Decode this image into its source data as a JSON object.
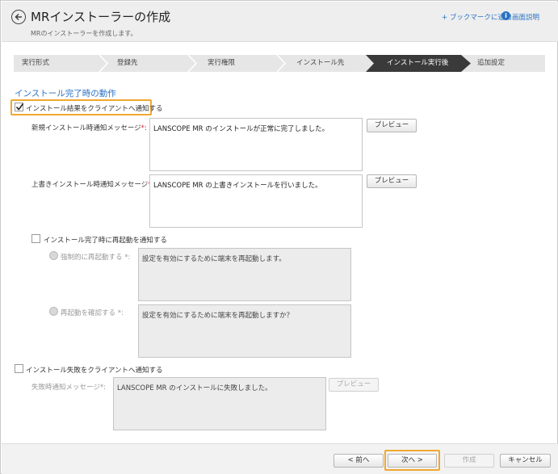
{
  "header": {
    "title": "MRインストーラーの作成",
    "subtitle": "MRのインストーラーを作成します。",
    "bookmark_label": "+ ブックマークに追加",
    "help_label": "画面説明",
    "info_glyph": "i"
  },
  "steps": [
    {
      "label": "実行形式",
      "active": false
    },
    {
      "label": "登録先",
      "active": false
    },
    {
      "label": "実行権限",
      "active": false
    },
    {
      "label": "インストール先",
      "active": false
    },
    {
      "label": "インストール実行後",
      "active": true
    },
    {
      "label": "追加設定",
      "active": false
    }
  ],
  "section": {
    "title": "インストール完了時の動作",
    "notify_result": {
      "label": "インストール結果をクライアントへ通知する",
      "checked": true
    },
    "new_install_msg": {
      "label": "新規インストール時通知メッセージ",
      "required_mark": "*",
      "colon": ":",
      "value": "LANSCOPE MR のインストールが正常に完了しました。",
      "preview_label": "プレビュー"
    },
    "overwrite_install_msg": {
      "label": "上書きインストール時通知メッセージ",
      "required_mark": "*",
      "colon": ":",
      "value": "LANSCOPE MR の上書きインストールを行いました。",
      "preview_label": "プレビュー"
    },
    "notify_restart": {
      "label": "インストール完了時に再起動を通知する",
      "checked": false,
      "force_restart": {
        "label": "強制的に再起動する *:",
        "value": "設定を有効にするために端末を再起動します。"
      },
      "confirm_restart": {
        "label": "再起動を確認する *:",
        "value": "設定を有効にするために端末を再起動しますか？"
      }
    },
    "notify_failure": {
      "label": "インストール失敗をクライアントへ通知する",
      "checked": false,
      "msg_label": "失敗時通知メッセージ*:",
      "value": "LANSCOPE MR のインストールに失敗しました。",
      "preview_label": "プレビュー"
    }
  },
  "footer": {
    "prev_label": "< 前へ",
    "next_label": "次へ >",
    "create_label": "作成",
    "cancel_label": "キャンセル"
  },
  "colors": {
    "accent": "#2a72c4",
    "highlight": "#f0a830",
    "active_step": "#3a3a3a",
    "required": "#e02020"
  }
}
